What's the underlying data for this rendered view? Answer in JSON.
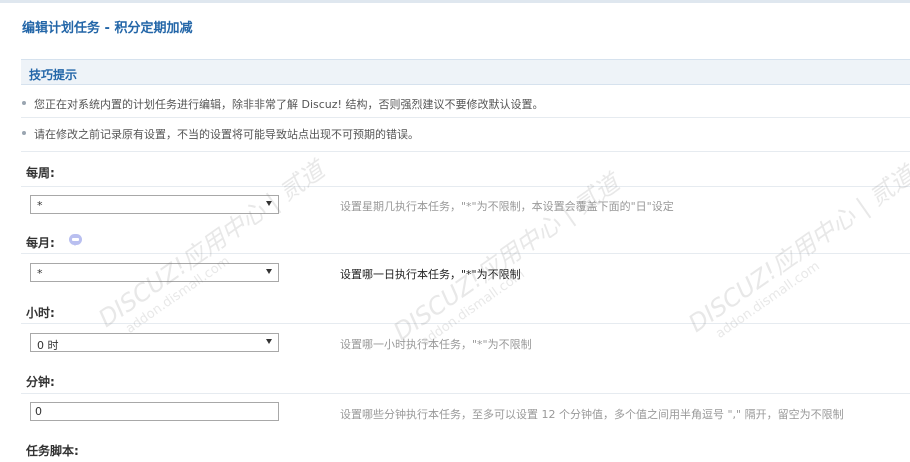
{
  "page": {
    "title": "编辑计划任务 - 积分定期加减"
  },
  "tips": {
    "title": "技巧提示",
    "items": [
      "您正在对系统内置的计划任务进行编辑，除非非常了解 Discuz! 结构，否则强烈建议不要修改默认设置。",
      "请在修改之前记录原有设置，不当的设置将可能导致站点出现不可预期的错误。"
    ]
  },
  "fields": {
    "weekly": {
      "label": "每周:",
      "value": "*",
      "hint": "设置星期几执行本任务，\"*\"为不限制，本设置会覆盖下面的\"日\"设定"
    },
    "monthly": {
      "label": "每月:",
      "value": "*",
      "hint": "设置哪一日执行本任务，\"*\"为不限制"
    },
    "hour": {
      "label": "小时:",
      "value": "0 时",
      "hint": "设置哪一小时执行本任务，\"*\"为不限制"
    },
    "minute": {
      "label": "分钟:",
      "value": "0",
      "hint": "设置哪些分钟执行本任务，至多可以设置 12 个分钟值，多个值之间用半角逗号 \",\" 隔开，留空为不限制"
    },
    "script": {
      "label": "任务脚本:"
    }
  },
  "watermark": {
    "main": "DISCUZ!应用中心 | 贰道",
    "sub": "addon.dismall.com"
  },
  "colors": {
    "title": "#2366a8",
    "tips_bg": "#eef3f8",
    "help_icon": "#b9bff0"
  }
}
